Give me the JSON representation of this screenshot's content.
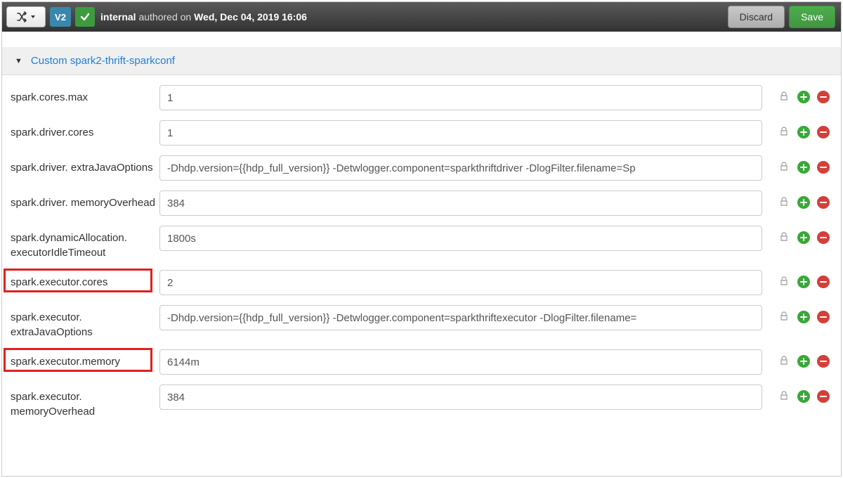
{
  "topbar": {
    "version": "V2",
    "author": "internal",
    "middle": " authored on ",
    "date": "Wed, Dec 04, 2019 16:06",
    "discard": "Discard",
    "save": "Save"
  },
  "section": {
    "title": "Custom spark2-thrift-sparkconf"
  },
  "rows": [
    {
      "label": "spark.cores.max",
      "value": "1",
      "highlight": false
    },
    {
      "label": "spark.driver.cores",
      "value": "1",
      "highlight": false
    },
    {
      "label": "spark.driver. extraJavaOptions",
      "value": "-Dhdp.version={{hdp_full_version}} -Detwlogger.component=sparkthriftdriver -DlogFilter.filename=Sp",
      "highlight": false
    },
    {
      "label": "spark.driver. memoryOverhead",
      "value": "384",
      "highlight": false
    },
    {
      "label": "spark.dynamicAllocation. executorIdleTimeout",
      "value": "1800s",
      "highlight": false
    },
    {
      "label": "spark.executor.cores",
      "value": "2",
      "highlight": true
    },
    {
      "label": "spark.executor. extraJavaOptions",
      "value": "-Dhdp.version={{hdp_full_version}} -Detwlogger.component=sparkthriftexecutor -DlogFilter.filename=",
      "highlight": false
    },
    {
      "label": "spark.executor.memory",
      "value": "6144m",
      "highlight": true
    },
    {
      "label": "spark.executor. memoryOverhead",
      "value": "384",
      "highlight": false
    }
  ]
}
